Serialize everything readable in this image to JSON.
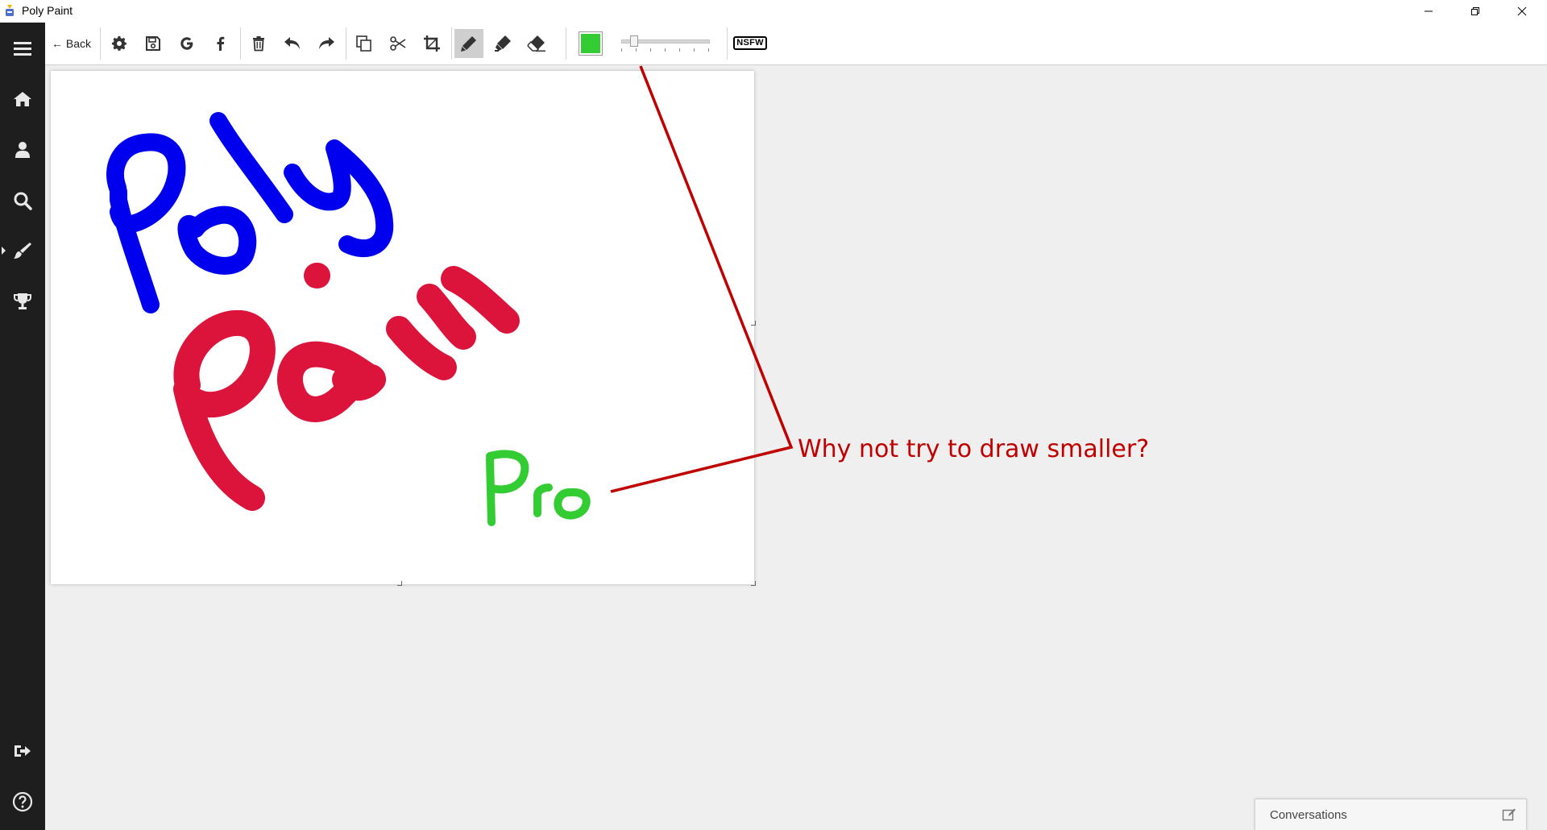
{
  "window": {
    "title": "Poly Paint",
    "controls": [
      "minimize",
      "restore",
      "close"
    ]
  },
  "sidebar": {
    "items": [
      {
        "name": "menu",
        "icon": "hamburger-icon"
      },
      {
        "name": "home",
        "icon": "home-icon"
      },
      {
        "name": "profile",
        "icon": "user-icon"
      },
      {
        "name": "search",
        "icon": "search-icon"
      },
      {
        "name": "paint",
        "icon": "brush-icon",
        "active": true
      },
      {
        "name": "achievements",
        "icon": "trophy-icon"
      },
      {
        "name": "logout",
        "icon": "sign-out-icon"
      },
      {
        "name": "help",
        "icon": "help-icon"
      }
    ]
  },
  "toolbar": {
    "back_label": "← Back",
    "tools": [
      "settings",
      "save",
      "google",
      "facebook",
      "delete",
      "undo",
      "redo",
      "duplicate",
      "cut",
      "crop",
      "pencil",
      "marker",
      "eraser"
    ],
    "active_tool": "pencil",
    "current_color": "#33cc33",
    "size_slider_level": 0.15,
    "nsfw_label": "NSFW"
  },
  "canvas": {
    "background": "#ffffff",
    "strokes": [
      {
        "text": "Poly",
        "color": "#0000ee"
      },
      {
        "text": "Paint",
        "color": "#dc143c"
      },
      {
        "text": "Pro",
        "color": "#33cc33"
      }
    ]
  },
  "annotation": {
    "text": "Why not try to draw smaller?",
    "color": "#c00000"
  },
  "conversations": {
    "label": "Conversations"
  }
}
